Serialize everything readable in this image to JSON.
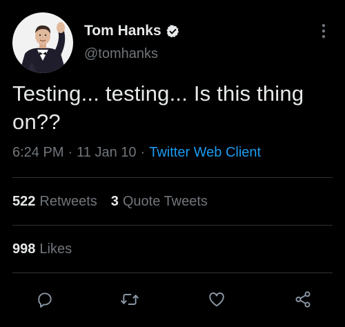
{
  "author": {
    "display_name": "Tom Hanks",
    "handle": "@tomhanks",
    "verified": true,
    "avatar_icon": "profile-photo"
  },
  "tweet": {
    "text": "Testing... testing... Is this thing on??",
    "time": "6:24 PM",
    "date": "11 Jan 10",
    "separator": "·",
    "client": "Twitter Web Client"
  },
  "stats": {
    "retweets_count": "522",
    "retweets_label": "Retweets",
    "quotes_count": "3",
    "quotes_label": "Quote Tweets",
    "likes_count": "998",
    "likes_label": "Likes"
  },
  "actions": [
    {
      "name": "reply",
      "icon": "comment-icon"
    },
    {
      "name": "retweet",
      "icon": "retweet-icon"
    },
    {
      "name": "like",
      "icon": "heart-icon"
    },
    {
      "name": "share",
      "icon": "share-icon"
    }
  ],
  "colors": {
    "background": "#000000",
    "text_primary": "#e7e9ea",
    "text_secondary": "#71767b",
    "accent": "#1d9bf0",
    "divider": "#2f3336"
  }
}
